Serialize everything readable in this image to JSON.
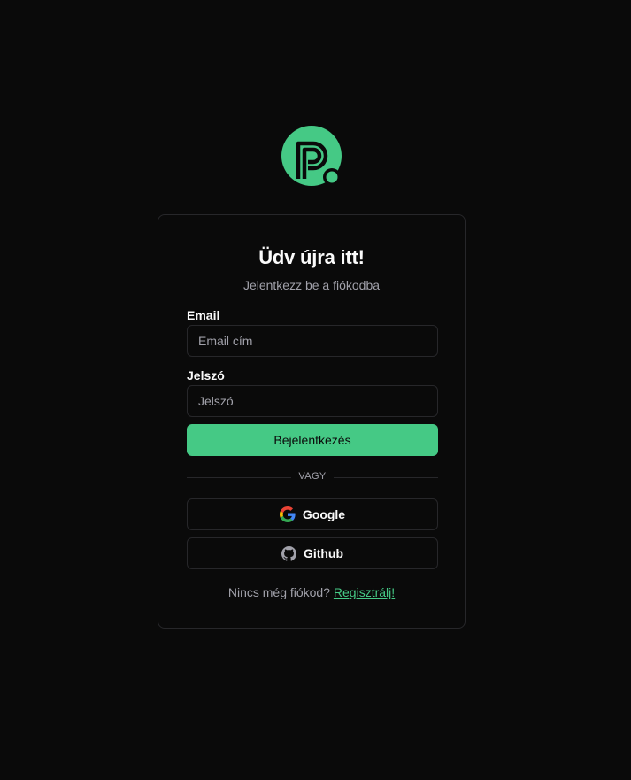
{
  "brand": {
    "logo_icon": "p-logo-icon",
    "accent_color": "#45c985"
  },
  "card": {
    "title": "Üdv újra itt!",
    "subtitle": "Jelentkezz be a fiókodba"
  },
  "form": {
    "email": {
      "label": "Email",
      "placeholder": "Email cím",
      "value": ""
    },
    "password": {
      "label": "Jelszó",
      "placeholder": "Jelszó",
      "value": ""
    },
    "submit_label": "Bejelentkezés"
  },
  "divider_text": "VAGY",
  "oauth": {
    "google": {
      "label": "Google",
      "icon": "google-icon"
    },
    "github": {
      "label": "Github",
      "icon": "github-icon"
    }
  },
  "footer": {
    "text": "Nincs még fiókod?",
    "link_label": "Regisztrálj!"
  }
}
